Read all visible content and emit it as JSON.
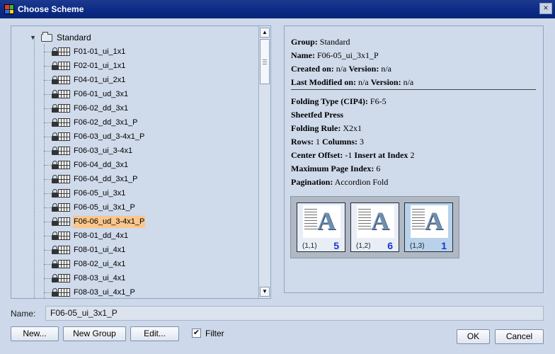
{
  "window": {
    "title": "Choose Scheme",
    "close_glyph": "×"
  },
  "tree": {
    "root_label": "Standard",
    "selected_index": 12,
    "items": [
      "F01-01_ui_1x1",
      "F02-01_ui_1x1",
      "F04-01_ui_2x1",
      "F06-01_ud_3x1",
      "F06-02_dd_3x1",
      "F06-02_dd_3x1_P",
      "F06-03_ud_3-4x1_P",
      "F06-03_ui_3-4x1",
      "F06-04_dd_3x1",
      "F06-04_dd_3x1_P",
      "F06-05_ui_3x1",
      "F06-05_ui_3x1_P",
      "F06-06_ud_3-4x1_P",
      "F08-01_dd_4x1",
      "F08-01_ui_4x1",
      "F08-02_ui_4x1",
      "F08-03_ui_4x1",
      "F08-03_ui_4x1_P"
    ]
  },
  "info": {
    "group_label": "Group:",
    "group_value": "Standard",
    "name_label": "Name:",
    "name_value": "F06-05_ui_3x1_P",
    "created_label": "Created on:",
    "created_value": "n/a",
    "version_label": "Version:",
    "version_value": "n/a",
    "modified_label": "Last Modified on:",
    "modified_value": "n/a",
    "version2_label": "Version:",
    "version2_value": "n/a",
    "folding_type_label": "Folding Type (CIP4):",
    "folding_type_value": "F6-5",
    "press_label": "Sheetfed Press",
    "folding_rule_label": "Folding Rule:",
    "folding_rule_value": "X2x1",
    "rows_label": "Rows:",
    "rows_value": "1",
    "columns_label": "Columns:",
    "columns_value": "3",
    "center_offset_label": "Center Offset:",
    "center_offset_value": "-1",
    "insert_label": "Insert at Index",
    "insert_value": "2",
    "max_page_label": "Maximum Page Index:",
    "max_page_value": "6",
    "pagination_label": "Pagination:",
    "pagination_value": "Accordion Fold"
  },
  "preview": {
    "pages": [
      {
        "coord": "(1,1)",
        "number": "5",
        "active": false
      },
      {
        "coord": "(1,2)",
        "number": "6",
        "active": false
      },
      {
        "coord": "(1,3)",
        "number": "1",
        "active": true
      }
    ],
    "glyph": "A"
  },
  "name_field": {
    "label": "Name:",
    "value": "F06-05_ui_3x1_P"
  },
  "buttons": {
    "new": "New...",
    "new_group": "New Group",
    "edit": "Edit...",
    "ok": "OK",
    "cancel": "Cancel"
  },
  "filter": {
    "label": "Filter",
    "checked": true,
    "check_glyph": "✔"
  },
  "scroll": {
    "up_glyph": "▲",
    "down_glyph": "▼"
  },
  "colors": {
    "titlebar": "#0b2a86",
    "selection": "#fbc68c",
    "page_number": "#1336d6"
  }
}
